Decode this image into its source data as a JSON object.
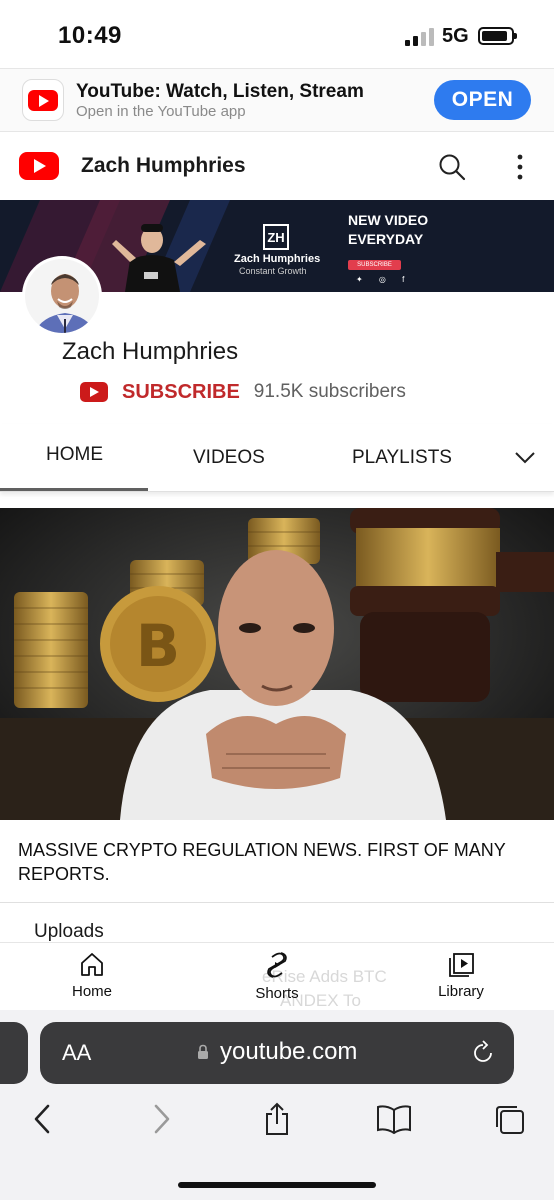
{
  "status_bar": {
    "time": "10:49",
    "network": "5G",
    "signal_bars_active": 2,
    "battery_level": 0.9
  },
  "app_banner": {
    "title": "YouTube: Watch, Listen, Stream",
    "subtitle": "Open in the YouTube app",
    "open_label": "OPEN",
    "icon": "youtube-logo-icon"
  },
  "header": {
    "channel_title": "Zach Humphries",
    "icons": [
      "youtube-logo-icon",
      "search-icon",
      "more-vertical-icon"
    ]
  },
  "channel_banner": {
    "logo_mark": "ZH",
    "name": "Zach Humphries",
    "tagline": "Constant Growth",
    "headline_line1": "NEW VIDEO",
    "headline_line2": "EVERYDAY",
    "subscribe_small": "SUBSCRIBE",
    "socials": "✦ ◎ f"
  },
  "channel": {
    "name": "Zach Humphries",
    "subscribe_label": "SUBSCRIBE",
    "subscriber_count": "91.5K subscribers"
  },
  "tabs": {
    "items": [
      "HOME",
      "VIDEOS",
      "PLAYLISTS"
    ],
    "active": "HOME",
    "overflow_icon": "chevron-down-icon"
  },
  "featured_video": {
    "title": "MASSIVE CRYPTO REGULATION NEWS. FIRST OF MANY REPORTS."
  },
  "sections": {
    "uploads_heading": "Uploads",
    "ghost_line1": "eRise Adds BTC",
    "ghost_line2": "ANDEX To"
  },
  "bottom_nav": {
    "items": [
      {
        "label": "Home",
        "icon": "home-icon"
      },
      {
        "label": "Shorts",
        "icon": "shorts-icon"
      },
      {
        "label": "Library",
        "icon": "library-icon"
      }
    ]
  },
  "safari": {
    "text_size_label": "AA",
    "url": "youtube.com",
    "icons": [
      "lock-icon",
      "reload-icon",
      "back-icon",
      "forward-icon",
      "share-icon",
      "bookmarks-icon",
      "tabs-icon"
    ]
  },
  "colors": {
    "youtube_red": "#ff0000",
    "subscribe_red": "#c0292b",
    "open_button_blue": "#2e7bef",
    "safari_pill": "#3a3a3c"
  }
}
